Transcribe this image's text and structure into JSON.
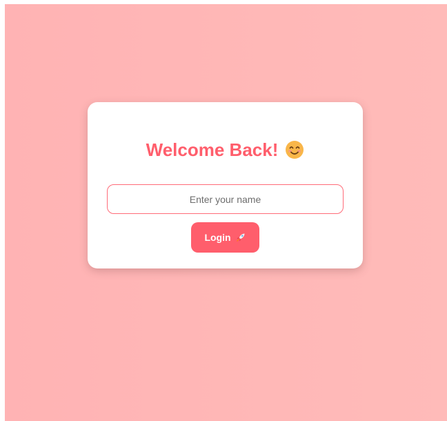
{
  "login_card": {
    "title": "Welcome Back!",
    "title_icon": "smiley-emoji-icon",
    "name_input": {
      "placeholder": "Enter your name",
      "value": ""
    },
    "login_button": {
      "label": "Login",
      "icon": "rocket-icon"
    }
  },
  "colors": {
    "accent": "#ff5e6c",
    "background_left": "#ffb3b4",
    "background_right": "#ffbbb9",
    "card": "#ffffff"
  }
}
